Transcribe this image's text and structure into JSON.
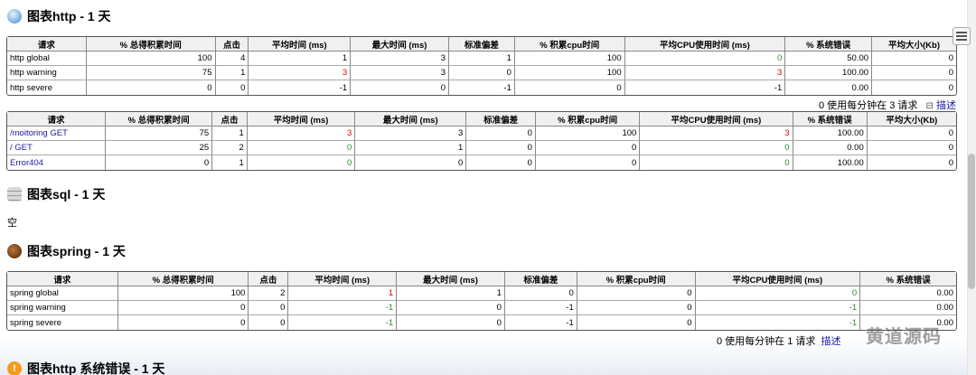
{
  "colors": {
    "link": "#1a1aa6",
    "red": "#e00000",
    "green": "#2a8a2a"
  },
  "section_http": {
    "title": "图表http - 1 天",
    "icon": "globe-icon"
  },
  "table1": {
    "headers": [
      "请求",
      "% 总得积累时间",
      "点击",
      "平均时间 (ms)",
      "最大时间 (ms)",
      "标准偏差",
      "% 积累cpu时间",
      "平均CPU使用时间 (ms)",
      "% 系统错误",
      "平均大小(Kb)"
    ],
    "rows": [
      [
        "http global",
        "100",
        "4",
        "1",
        "3",
        "1",
        "100",
        "0",
        "50.00",
        "0"
      ],
      [
        "http warning",
        "75",
        "1",
        "3",
        "3",
        "0",
        "100",
        "3",
        "100.00",
        "0"
      ],
      [
        "http severe",
        "0",
        "0",
        "-1",
        "0",
        "-1",
        "0",
        "-1",
        "0.00",
        "0"
      ]
    ]
  },
  "note1": {
    "text": "0 使用每分钟在 3 请求",
    "link": "描述"
  },
  "table2": {
    "headers": [
      "请求",
      "% 总得积累时间",
      "点击",
      "平均时间 (ms)",
      "最大时间 (ms)",
      "标准偏差",
      "% 积累cpu时间",
      "平均CPU使用时间 (ms)",
      "% 系统错误",
      "平均大小(Kb)"
    ],
    "rows": [
      [
        "/moitoring GET",
        "75",
        "1",
        "3",
        "3",
        "0",
        "100",
        "3",
        "100.00",
        "0"
      ],
      [
        "/ GET",
        "25",
        "2",
        "0",
        "1",
        "0",
        "0",
        "0",
        "0.00",
        "0"
      ],
      [
        "Error404",
        "0",
        "1",
        "0",
        "0",
        "0",
        "0",
        "0",
        "100.00",
        "0"
      ]
    ]
  },
  "section_sql": {
    "title": "图表sql - 1 天",
    "icon": "database-icon",
    "empty": "空"
  },
  "section_spring": {
    "title": "图表spring - 1 天",
    "icon": "coffee-bean-icon"
  },
  "table3": {
    "headers": [
      "请求",
      "% 总得积累时间",
      "点击",
      "平均时间 (ms)",
      "最大时间 (ms)",
      "标准偏差",
      "% 积累cpu时间",
      "平均CPU使用时间 (ms)",
      "% 系统错误"
    ],
    "rows": [
      [
        "spring global",
        "100",
        "2",
        "1",
        "1",
        "0",
        "0",
        "0",
        "0.00"
      ],
      [
        "spring warning",
        "0",
        "0",
        "-1",
        "0",
        "-1",
        "0",
        "-1",
        "0.00"
      ],
      [
        "spring severe",
        "0",
        "0",
        "-1",
        "0",
        "-1",
        "0",
        "-1",
        "0.00"
      ]
    ]
  },
  "note3": {
    "text": "0 使用每分钟在 1 请求",
    "link": "描述"
  },
  "section_errors": {
    "title": "图表http 系统错误 - 1 天",
    "icon": "warning-icon"
  },
  "watermark": "黄道源码"
}
